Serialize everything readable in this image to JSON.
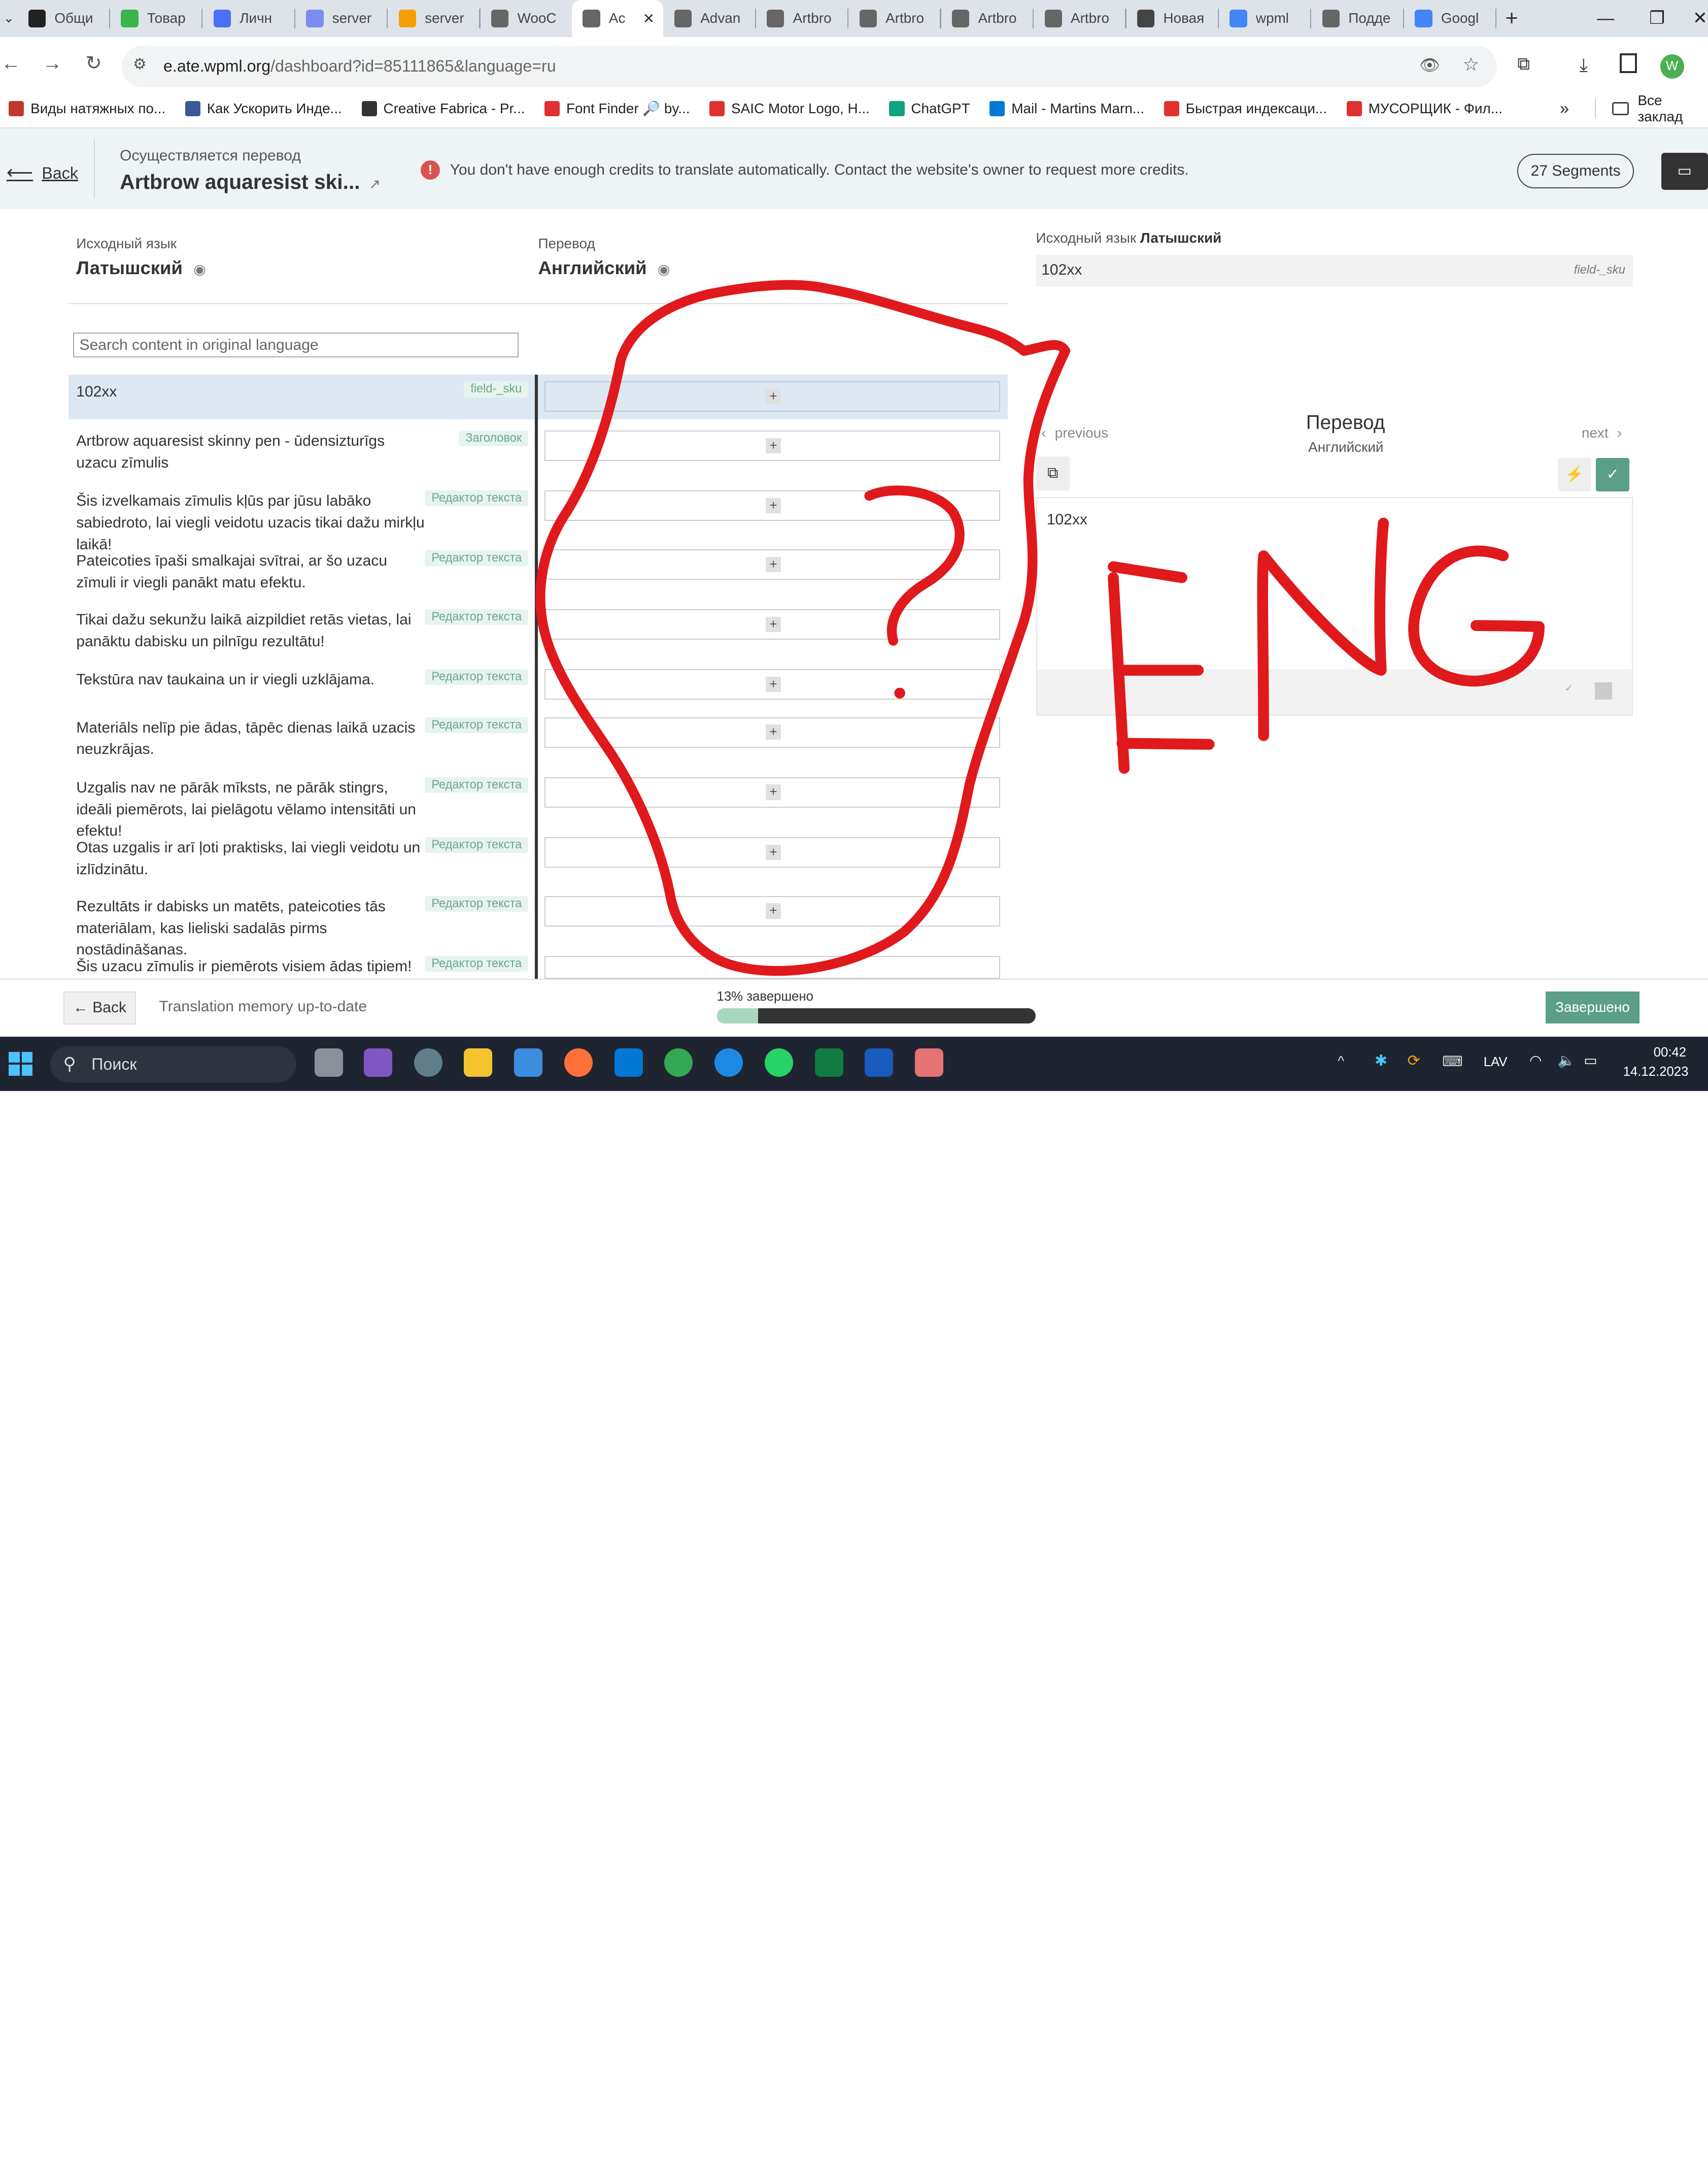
{
  "browser": {
    "tabs": [
      {
        "label": "Общи",
        "color": "#222"
      },
      {
        "label": "Товар",
        "color": "#3bb54a"
      },
      {
        "label": "Личн",
        "color": "#4c6ef5"
      },
      {
        "label": "server",
        "color": "#7b8cf0"
      },
      {
        "label": "server",
        "color": "#f59f00"
      },
      {
        "label": "WooC",
        "color": "#666"
      },
      {
        "label": "Ac",
        "color": "#666",
        "active": true
      },
      {
        "label": "Advan",
        "color": "#666"
      },
      {
        "label": "Artbro",
        "color": "#666"
      },
      {
        "label": "Artbro",
        "color": "#666"
      },
      {
        "label": "Artbro",
        "color": "#666"
      },
      {
        "label": "Artbro",
        "color": "#666"
      },
      {
        "label": "Новая",
        "color": "#444"
      },
      {
        "label": "wpml",
        "color": "#4285f4"
      },
      {
        "label": "Подде",
        "color": "#666"
      },
      {
        "label": "Googl",
        "color": "#4285f4"
      }
    ],
    "url_host": "e.ate.wpml.org",
    "url_path": "/dashboard?id=85111865&language=ru",
    "profile_initial": "W",
    "bookmarks": [
      {
        "label": "Виды натяжных по...",
        "color": "#c0392b"
      },
      {
        "label": "Как Ускорить Инде...",
        "color": "#3b5998"
      },
      {
        "label": "Creative Fabrica - Pr...",
        "color": "#333"
      },
      {
        "label": "Font Finder 🔎 by...",
        "color": "#e03131"
      },
      {
        "label": "SAIC Motor Logo, H...",
        "color": "#e03131"
      },
      {
        "label": "ChatGPT",
        "color": "#10a37f"
      },
      {
        "label": "Mail - Martins Marn...",
        "color": "#0078d4"
      },
      {
        "label": "Быстрая индексаци...",
        "color": "#e03131"
      },
      {
        "label": "МУСОРЩИК - Фил...",
        "color": "#e03131"
      }
    ],
    "bookmarks_more": "»",
    "all_bookmarks": "Все заклад"
  },
  "header": {
    "back": "Back",
    "subtitle": "Осуществляется перевод",
    "title": "Artbrow aquaresist ski...",
    "warning": "You don't have enough credits to translate automatically. Contact the website's owner to request more credits.",
    "segments": "27 Segments"
  },
  "columns": {
    "source_label": "Исходный язык",
    "source_lang": "Латышский",
    "target_label": "Перевод",
    "target_lang": "Английский",
    "search_placeholder": "Search content in original language"
  },
  "rows": [
    {
      "text": "102xx",
      "tag": "field-_sku"
    },
    {
      "text": "Artbrow aquaresist skinny pen - ūdensizturīgs uzacu zīmulis",
      "tag": "Заголовок"
    },
    {
      "text": "Šis izvelkamais zīmulis kļūs par jūsu labāko sabiedroto, lai viegli veidotu uzacis tikai dažu mirkļu laikā!",
      "tag": "Редактор текста"
    },
    {
      "text": "Pateicoties īpaši smalkajai svītrai, ar šo uzacu zīmuli ir viegli panākt matu efektu.",
      "tag": "Редактор текста"
    },
    {
      "text": "Tikai dažu sekunžu laikā aizpildiet retās vietas, lai panāktu dabisku un pilnīgu rezultātu!",
      "tag": "Редактор текста"
    },
    {
      "text": "Tekstūra nav taukaina un ir viegli uzklājama.",
      "tag": "Редактор текста"
    },
    {
      "text": "Materiāls nelīp pie ādas, tāpēc dienas laikā uzacis neuzkrājas.",
      "tag": "Редактор текста"
    },
    {
      "text": "Uzgalis nav ne pārāk mīksts, ne pārāk stingrs, ideāli piemērots, lai pielāgotu vēlamo intensitāti un efektu!",
      "tag": "Редактор текста"
    },
    {
      "text": "Otas uzgalis ir arī ļoti praktisks, lai viegli veidotu un izlīdzinātu.",
      "tag": "Редактор текста"
    },
    {
      "text": "Rezultāts ir dabisks un matēts, pateicoties tās materiālam, kas lieliski sadalās pirms nostādināšanas.",
      "tag": "Редактор текста"
    },
    {
      "text": "Šis uzacu zīmulis ir piemērots visiem ādas tipiem!",
      "tag": "Редактор текста"
    }
  ],
  "panel": {
    "source_label": "Исходный язык",
    "source_lang": "Латышский",
    "source_value": "102xx",
    "source_field": "field-_sku",
    "previous": "previous",
    "next": "next",
    "title": "Перевод",
    "lang": "Английский",
    "editor_value": "102xx"
  },
  "footer": {
    "back": "← Back",
    "memory": "Translation memory up-to-date",
    "progress_label": "13% завершено",
    "progress": 0.13,
    "done": "Завершено"
  },
  "taskbar": {
    "search": "Поиск",
    "lang": "LAV",
    "time": "00:42",
    "date": "14.12.2023"
  },
  "annotation": {
    "text": "ENG",
    "question": "?",
    "color": "#e0191c"
  }
}
